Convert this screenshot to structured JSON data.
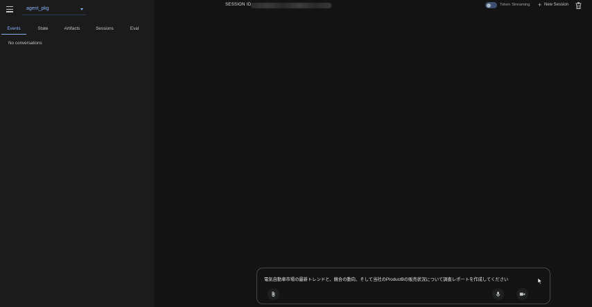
{
  "sidebar": {
    "app_name": "agent_pkg",
    "tabs": [
      {
        "label": "Events",
        "active": true
      },
      {
        "label": "State",
        "active": false
      },
      {
        "label": "Artifacts",
        "active": false
      },
      {
        "label": "Sessions",
        "active": false
      },
      {
        "label": "Eval",
        "active": false
      }
    ],
    "empty_text": "No conversations"
  },
  "topbar": {
    "session_label": "SESSION ID",
    "token_streaming_label": "Token Streaming",
    "new_session_label": "New Session"
  },
  "composer": {
    "prompt_text": "電気自動車市場の最新トレンドと、競合の動向、そして当社のProductBの販売状況について調査レポートを作成してください"
  },
  "icons": {
    "menu": "menu-icon",
    "dropdown": "chevron-down-icon",
    "add": "plus-icon",
    "delete": "trash-icon",
    "attach": "paperclip-icon",
    "mic": "mic-icon",
    "camera": "video-camera-icon",
    "pointer": "mouse-cursor-icon"
  },
  "colors": {
    "accent": "#8ab4f8",
    "background": "#131314",
    "sidebar": "#1b1b1c",
    "text": "#e3e3e3"
  }
}
